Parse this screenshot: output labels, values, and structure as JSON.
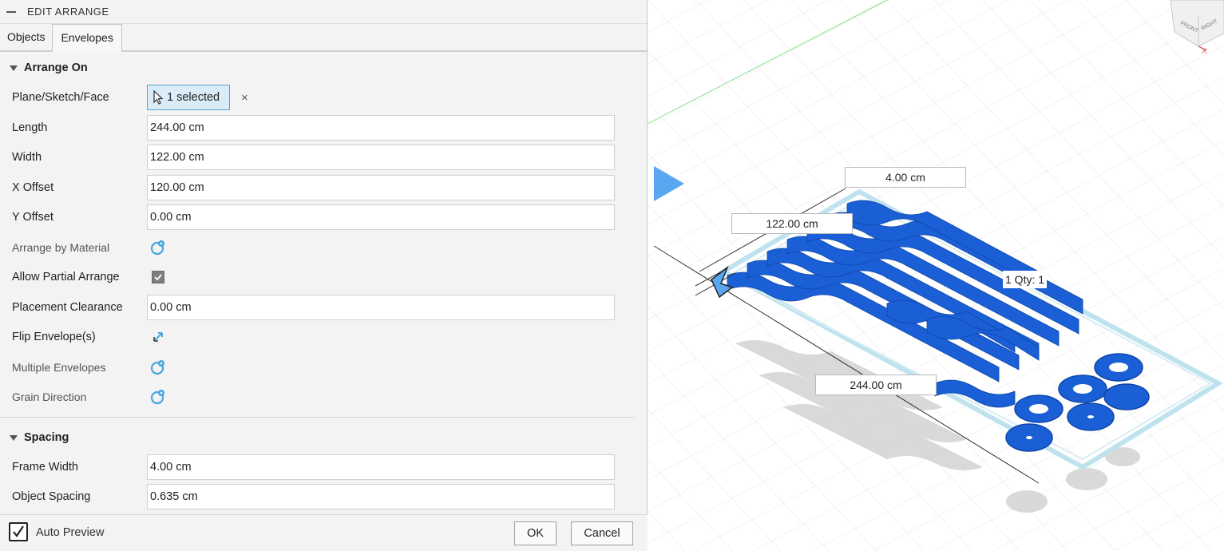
{
  "panel": {
    "title": "EDIT ARRANGE",
    "tabs": [
      {
        "label": "Objects",
        "active": false
      },
      {
        "label": "Envelopes",
        "active": true
      }
    ],
    "arrange_on": {
      "heading": "Arrange On",
      "plane_label": "Plane/Sketch/Face",
      "plane_value": "1 selected",
      "clear_glyph": "×",
      "length_label": "Length",
      "length_value": "244.00 cm",
      "width_label": "Width",
      "width_value": "122.00 cm",
      "x_offset_label": "X Offset",
      "x_offset_value": "120.00 cm",
      "y_offset_label": "Y Offset",
      "y_offset_value": "0.00 cm",
      "arrange_by_material_label": "Arrange by Material",
      "allow_partial_label": "Allow Partial Arrange",
      "allow_partial_checked": true,
      "placement_clearance_label": "Placement Clearance",
      "placement_clearance_value": "0.00 cm",
      "flip_label": "Flip Envelope(s)",
      "multiple_envelopes_label": "Multiple Envelopes",
      "grain_direction_label": "Grain Direction"
    },
    "spacing": {
      "heading": "Spacing",
      "frame_width_label": "Frame Width",
      "frame_width_value": "4.00 cm",
      "object_spacing_label": "Object Spacing",
      "object_spacing_value": "0.635 cm"
    },
    "footer": {
      "auto_preview_label": "Auto Preview",
      "auto_preview_checked": true,
      "ok_label": "OK",
      "cancel_label": "Cancel"
    }
  },
  "viewport": {
    "dim_frame": "4.00 cm",
    "dim_width": "122.00 cm",
    "dim_length": "244.00 cm",
    "qty_label": "1 Qty: 1",
    "viewcube": {
      "front": "FRONT",
      "right": "RIGHT",
      "axis_x": "X"
    }
  },
  "colors": {
    "part_blue": "#1a5fd6",
    "envelope_cyan": "#bfe3ee",
    "grid": "#e4e4e4",
    "selection_blue": "#d9ecf7"
  }
}
